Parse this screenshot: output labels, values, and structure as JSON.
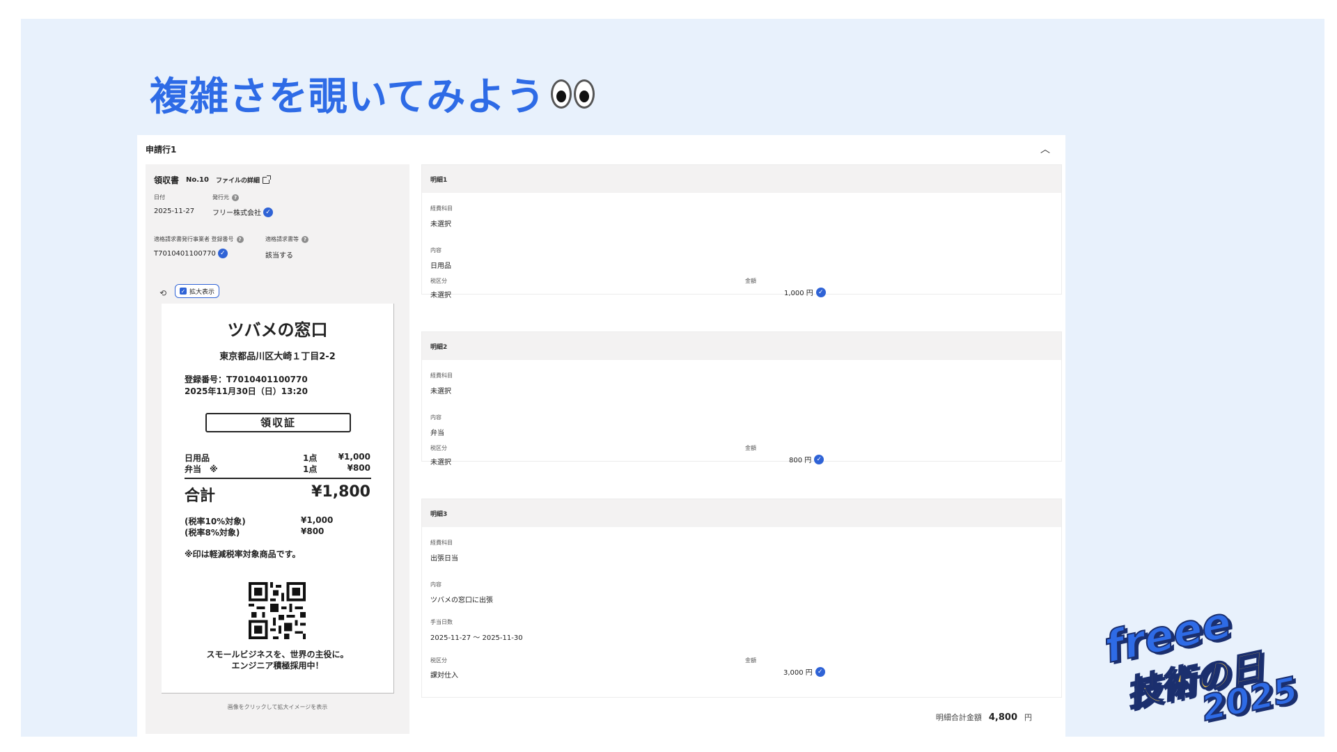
{
  "slide": {
    "title": "複雑さを覗いてみよう",
    "logo": {
      "brand": "freee",
      "event_jp": "技術の日",
      "year": "2025"
    }
  },
  "card": {
    "title": "申請行1",
    "collapse_icon": "chevron-up-icon"
  },
  "document": {
    "type": "領収書",
    "number": "No.10",
    "file_link": "ファイルの詳細",
    "date_label": "日付",
    "date_value": "2025-11-27",
    "issuer_label": "発行元",
    "issuer_value": "フリー株式会社",
    "reg_label": "適格請求書発行事業者 登録番号",
    "reg_value": "T7010401100770",
    "invoice_label": "適格請求書等",
    "invoice_value": "該当する",
    "zoom_label": "拡大表示",
    "caption": "画像をクリックして拡大イメージを表示"
  },
  "receipt": {
    "shop": "ツバメの窓口",
    "address": "東京都品川区大崎１丁目2-2",
    "reg": "登録番号：T7010401100770",
    "datetime": "2025年11月30日（日）13:20",
    "stamp": "領収証",
    "lines": [
      {
        "name": "日用品",
        "qty": "1点",
        "price": "¥1,000"
      },
      {
        "name": "弁当　※",
        "qty": "1点",
        "price": "¥800"
      }
    ],
    "total_label": "合計",
    "total_value": "¥1,800",
    "tax10_label": "(税率10%対象)",
    "tax10_value": "¥1,000",
    "tax8_label": "(税率8%対象)",
    "tax8_value": "¥800",
    "note": "※印は軽減税率対象商品です。",
    "footer1": "スモールビジネスを、世界の主役に。",
    "footer2": "エンジニア積極採用中！"
  },
  "items": [
    {
      "title": "明細1",
      "account_label": "経費科目",
      "account_value": "未選択",
      "content_label": "内容",
      "content_value": "日用品",
      "tax_label": "税区分",
      "tax_value": "未選択",
      "amount_label": "金額",
      "amount_value": "1,000 円"
    },
    {
      "title": "明細2",
      "account_label": "経費科目",
      "account_value": "未選択",
      "content_label": "内容",
      "content_value": "弁当",
      "tax_label": "税区分",
      "tax_value": "未選択",
      "amount_label": "金額",
      "amount_value": "800 円"
    },
    {
      "title": "明細3",
      "account_label": "経費科目",
      "account_value": "出張日当",
      "content_label": "内容",
      "content_value": "ツバメの窓口に出張",
      "days_label": "手当日数",
      "days_value": "2025-11-27 〜 2025-11-30",
      "tax_label": "税区分",
      "tax_value": "課対仕入",
      "amount_label": "金額",
      "amount_value": "3,000 円"
    }
  ],
  "total": {
    "label": "明細合計金額",
    "value": "4,800",
    "unit": "円"
  },
  "colors": {
    "accent": "#2e6be6",
    "check": "#2f63d6",
    "slide_bg": "#e8f1fc",
    "panel_bg": "#f3f2f2"
  }
}
